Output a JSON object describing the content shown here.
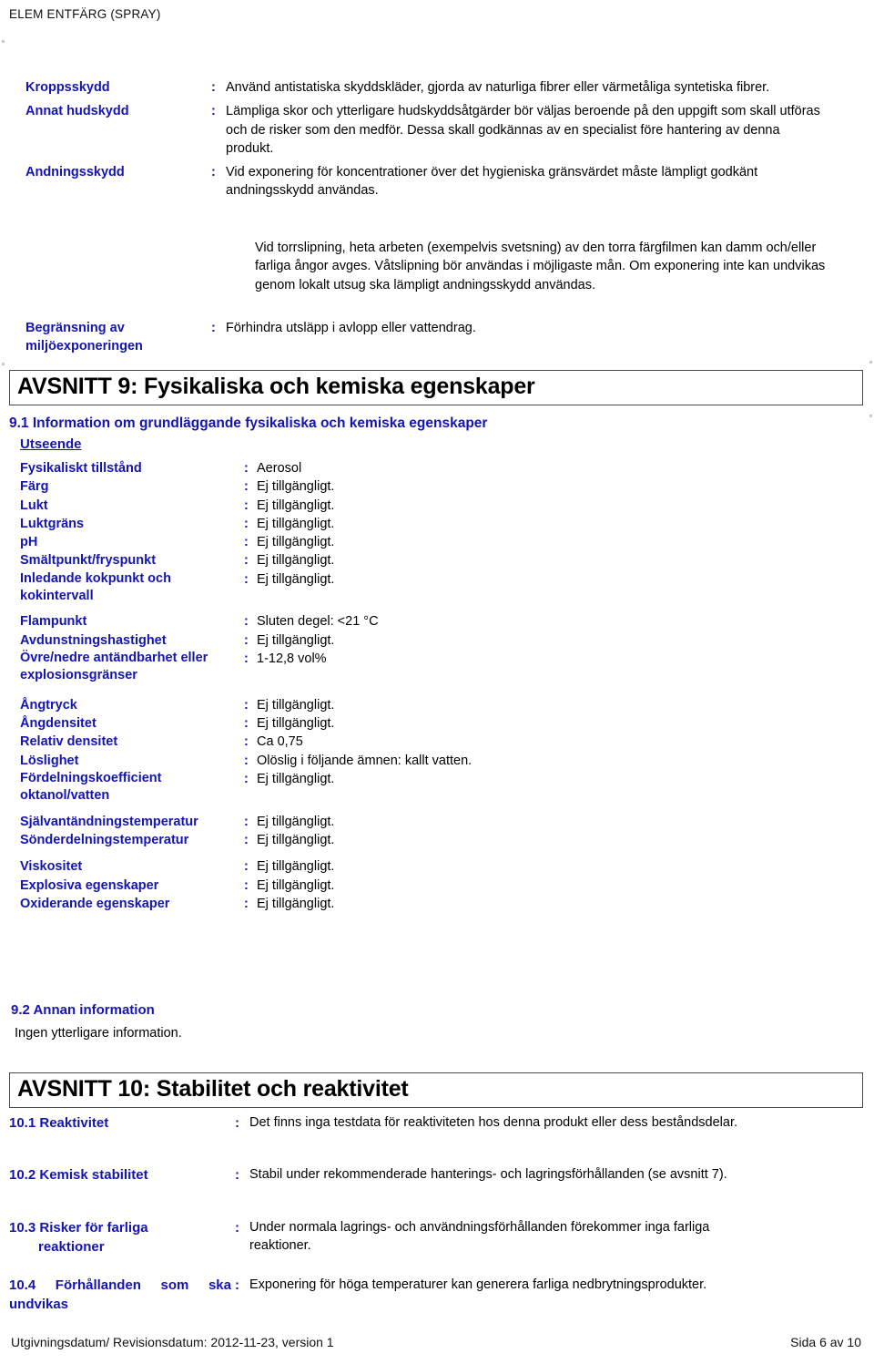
{
  "document": {
    "running_head": "ELEM ENTFÄRG (SPRAY)",
    "label_color": "#1414b4",
    "text_color": "#000000"
  },
  "protection": {
    "rows": [
      {
        "label": "Kroppsskydd",
        "colon": ":",
        "value": "Använd antistatiska skyddskläder, gjorda av naturliga fibrer eller värmetåliga syntetiska fibrer."
      },
      {
        "label": "Annat hudskydd",
        "colon": ":",
        "value": "Lämpliga skor och ytterligare hudskyddsåtgärder bör väljas beroende på den uppgift som skall utföras och de risker som den medför. Dessa skall godkännas av en specialist före hantering av denna produkt."
      },
      {
        "label": "Andningsskydd",
        "colon": ":",
        "value": "Vid exponering för koncentrationer över det hygieniska gränsvärdet måste lämpligt godkänt andningsskydd användas."
      }
    ],
    "note": "Vid torrslipning, heta arbeten (exempelvis svetsning) av den torra färgfilmen kan damm och/eller farliga ångor avges. Våtslipning bör användas i möjligaste mån. Om exponering inte kan undvikas genom lokalt utsug ska lämpligt andningsskydd användas.",
    "limit_row": {
      "label_line1": "Begränsning av",
      "label_line2": "miljöexponeringen",
      "colon": ":",
      "value": "Förhindra utsläpp i avlopp eller vattendrag."
    }
  },
  "section9": {
    "banner": "AVSNITT 9: Fysikaliska och kemiska egenskaper",
    "sub_heading": "9.1 Information om grundläggande fysikaliska och kemiska egenskaper",
    "appearance_label": "Utseende",
    "colon": ":",
    "properties": [
      {
        "label": "Fysikaliskt tillstånd",
        "value": "Aerosol"
      },
      {
        "label": "Färg",
        "value": "Ej tillgängligt."
      },
      {
        "label": "Lukt",
        "value": "Ej tillgängligt."
      },
      {
        "label": "Luktgräns",
        "value": "Ej tillgängligt."
      },
      {
        "label": "pH",
        "value": "Ej tillgängligt."
      },
      {
        "label": "Smältpunkt/fryspunkt",
        "value": "Ej tillgängligt."
      },
      {
        "label": "Inledande kokpunkt och kokintervall",
        "value": "Ej tillgängligt."
      },
      {
        "label": "Flampunkt",
        "value": "Sluten degel: <21 °C"
      },
      {
        "label": "Avdunstningshastighet",
        "value": "Ej tillgängligt."
      },
      {
        "label": "Övre/nedre antändbarhet eller explosionsgränser",
        "value": "1-12,8 vol%"
      },
      {
        "label": "Ångtryck",
        "value": "Ej tillgängligt."
      },
      {
        "label": "Ångdensitet",
        "value": "Ej tillgängligt."
      },
      {
        "label": "Relativ densitet",
        "value": "Ca 0,75"
      },
      {
        "label": "Löslighet",
        "value": "Olöslig i följande ämnen: kallt vatten."
      },
      {
        "label": "Fördelningskoefficient oktanol/vatten",
        "value": "Ej tillgängligt."
      },
      {
        "label": "Självantändningstemperatur",
        "value": "Ej tillgängligt."
      },
      {
        "label": "Sönderdelningstemperatur",
        "value": "Ej tillgängligt."
      },
      {
        "label": "Viskositet",
        "value": "Ej tillgängligt."
      },
      {
        "label": "Explosiva egenskaper",
        "value": "Ej tillgängligt."
      },
      {
        "label": "Oxiderande egenskaper",
        "value": "Ej tillgängligt."
      }
    ],
    "other_info_heading": "9.2 Annan information",
    "other_info_text": "Ingen ytterligare information."
  },
  "section10": {
    "banner": "AVSNITT 10: Stabilitet och reaktivitet",
    "colon": ":",
    "rows": [
      {
        "label": "10.1 Reaktivitet",
        "value": "Det finns inga testdata för reaktiviteten hos denna produkt eller dess beståndsdelar."
      },
      {
        "label": "10.2 Kemisk stabilitet",
        "value": "Stabil under rekommenderade hanterings- och lagringsförhållanden (se avsnitt 7)."
      },
      {
        "label_line1": "10.3 Risker för farliga",
        "label_line2": "reaktioner",
        "value": "Under normala lagrings- och användningsförhållanden förekommer inga farliga reaktioner."
      }
    ],
    "row_104": {
      "label_line1": "10.4 Förhållanden som ska",
      "label_line2": "undvikas",
      "value": "Exponering för höga temperaturer kan generera farliga nedbrytningsprodukter."
    }
  },
  "footer": {
    "left": "Utgivningsdatum/ Revisionsdatum: 2012-11-23, version 1",
    "right": "Sida 6 av 10"
  }
}
